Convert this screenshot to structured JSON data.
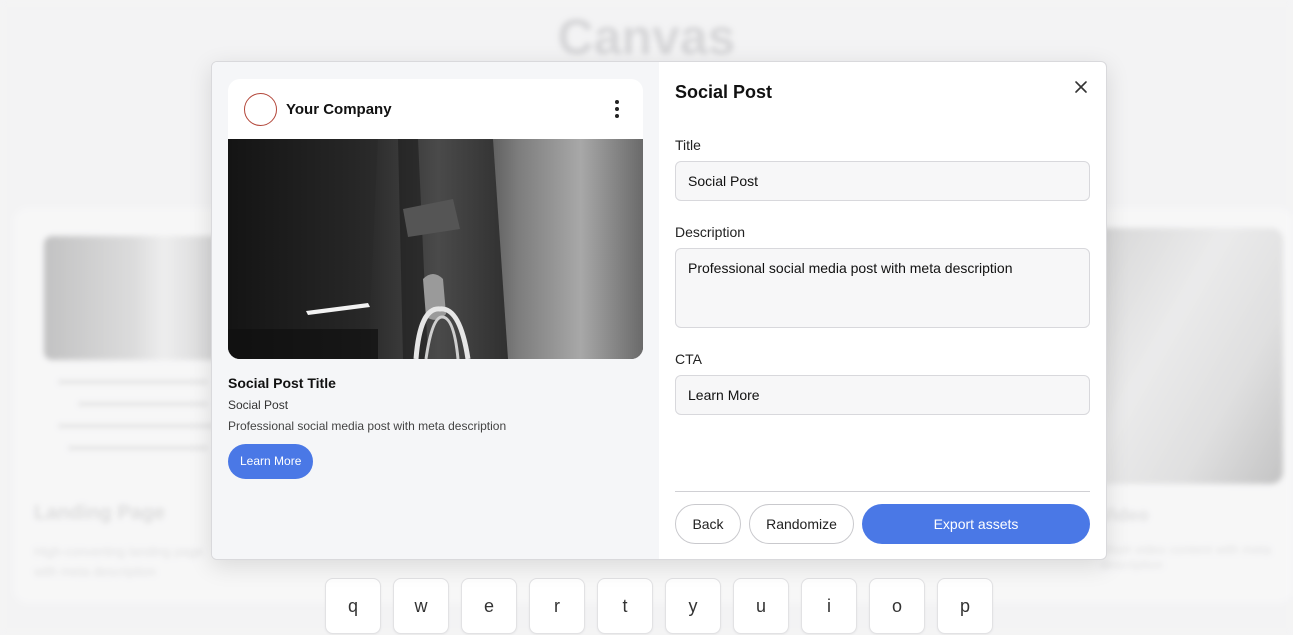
{
  "background": {
    "title": "Canvas",
    "left_card": {
      "title": "Landing Page",
      "description": "High-converting landing page with meta description"
    },
    "right_card": {
      "title": "Video",
      "description": "Short video content with meta description"
    }
  },
  "keyboard": {
    "keys": [
      "q",
      "w",
      "e",
      "r",
      "t",
      "y",
      "u",
      "i",
      "o",
      "p"
    ]
  },
  "modal": {
    "preview": {
      "company_name": "Your Company",
      "post_title": "Social Post Title",
      "post_subtitle": "Social Post",
      "post_description": "Professional social media post with meta description",
      "cta_label": "Learn More",
      "avatar_ring_color": "#b3473a"
    },
    "form": {
      "heading": "Social Post",
      "title_label": "Title",
      "title_value": "Social Post",
      "description_label": "Description",
      "description_value": "Professional social media post with meta description",
      "cta_label": "CTA",
      "cta_value": "Learn More",
      "back_label": "Back",
      "randomize_label": "Randomize",
      "export_label": "Export assets"
    },
    "colors": {
      "accent": "#4a78e6"
    }
  }
}
